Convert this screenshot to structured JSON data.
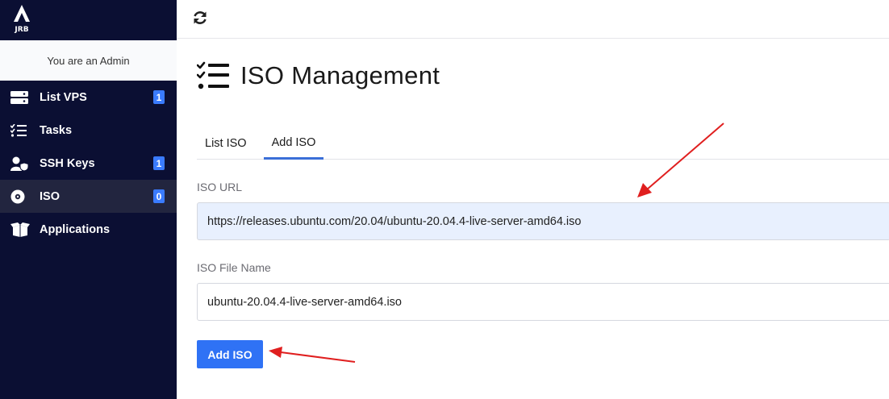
{
  "brand": {
    "logo_text": "JRB"
  },
  "admin_notice": "You are an Admin",
  "sidebar": {
    "items": [
      {
        "label": "List VPS",
        "icon": "server-icon",
        "badge": "1"
      },
      {
        "label": "Tasks",
        "icon": "task-list-icon",
        "badge": null
      },
      {
        "label": "SSH Keys",
        "icon": "user-key-icon",
        "badge": "1"
      },
      {
        "label": "ISO",
        "icon": "disc-icon",
        "badge": "0",
        "active": true
      },
      {
        "label": "Applications",
        "icon": "box-icon",
        "badge": null
      }
    ]
  },
  "topbar": {
    "refresh_icon": "refresh-icon"
  },
  "page": {
    "title": "ISO Management",
    "title_icon": "checklist-icon"
  },
  "tabs": [
    {
      "label": "List ISO",
      "active": false
    },
    {
      "label": "Add ISO",
      "active": true
    }
  ],
  "form": {
    "iso_url": {
      "label": "ISO URL",
      "value": "https://releases.ubuntu.com/20.04/ubuntu-20.04.4-live-server-amd64.iso"
    },
    "iso_file_name": {
      "label": "ISO File Name",
      "value": "ubuntu-20.04.4-live-server-amd64.iso"
    },
    "submit_label": "Add ISO"
  },
  "colors": {
    "sidebar_bg": "#0b0f33",
    "accent": "#2f72f5",
    "badge": "#3a7bff",
    "annotation_arrow": "#e01f1f"
  }
}
